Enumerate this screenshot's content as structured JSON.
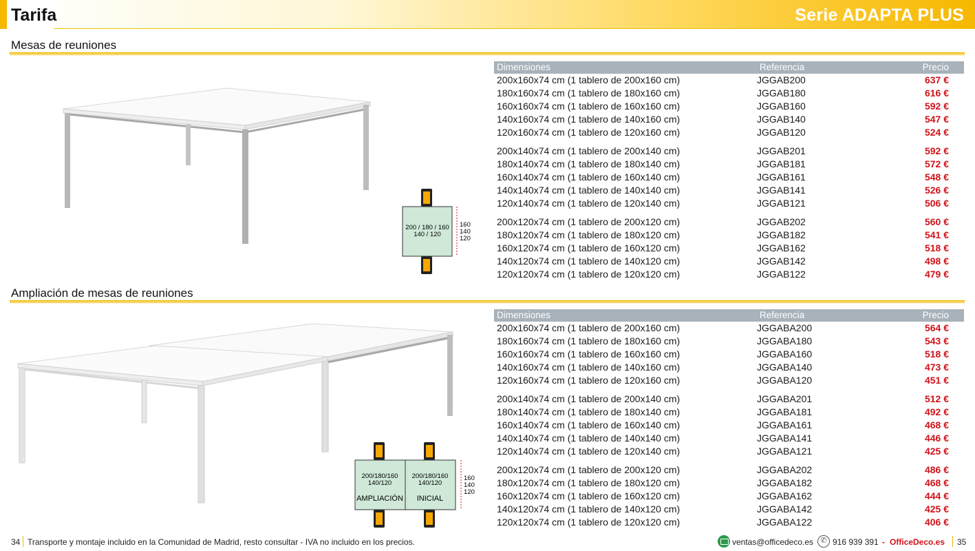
{
  "header": {
    "title": "Tarifa",
    "series": "Serie ADAPTA PLUS"
  },
  "sections": [
    {
      "title": "Mesas de reuniones",
      "table": {
        "headers": {
          "dim": "Dimensiones",
          "ref": "Referencia",
          "price": "Precio"
        },
        "groups": [
          [
            {
              "dim": "200x160x74 cm (1 tablero de 200x160 cm)",
              "ref": "JGGAB200",
              "price": "637 €"
            },
            {
              "dim": "180x160x74 cm (1 tablero de 180x160 cm)",
              "ref": "JGGAB180",
              "price": "616 €"
            },
            {
              "dim": "160x160x74 cm (1 tablero de 160x160 cm)",
              "ref": "JGGAB160",
              "price": "592 €"
            },
            {
              "dim": "140x160x74 cm (1 tablero de 140x160 cm)",
              "ref": "JGGAB140",
              "price": "547 €"
            },
            {
              "dim": "120x160x74 cm (1 tablero de 120x160 cm)",
              "ref": "JGGAB120",
              "price": "524 €"
            }
          ],
          [
            {
              "dim": "200x140x74 cm (1 tablero de 200x140 cm)",
              "ref": "JGGAB201",
              "price": "592 €"
            },
            {
              "dim": "180x140x74 cm (1 tablero de 180x140 cm)",
              "ref": "JGGAB181",
              "price": "572 €"
            },
            {
              "dim": "160x140x74 cm (1 tablero de 160x140 cm)",
              "ref": "JGGAB161",
              "price": "548 €"
            },
            {
              "dim": "140x140x74 cm (1 tablero de 140x140 cm)",
              "ref": "JGGAB141",
              "price": "526 €"
            },
            {
              "dim": "120x140x74 cm (1 tablero de 120x140 cm)",
              "ref": "JGGAB121",
              "price": "506 €"
            }
          ],
          [
            {
              "dim": "200x120x74 cm (1 tablero de 200x120 cm)",
              "ref": "JGGAB202",
              "price": "560 €"
            },
            {
              "dim": "180x120x74 cm (1 tablero de 180x120 cm)",
              "ref": "JGGAB182",
              "price": "541 €"
            },
            {
              "dim": "160x120x74 cm (1 tablero de 160x120 cm)",
              "ref": "JGGAB162",
              "price": "518 €"
            },
            {
              "dim": "140x120x74 cm (1 tablero de 140x120 cm)",
              "ref": "JGGAB142",
              "price": "498 €"
            },
            {
              "dim": "120x120x74 cm (1 tablero de 120x120 cm)",
              "ref": "JGGAB122",
              "price": "479 €"
            }
          ]
        ]
      },
      "diagram": {
        "width_label_1": "200 / 180 / 160",
        "width_label_2": "140 / 120",
        "depth_1": "160",
        "depth_2": "140",
        "depth_3": "120"
      }
    },
    {
      "title": "Ampliación de mesas de reuniones",
      "table": {
        "headers": {
          "dim": "Dimensiones",
          "ref": "Referencia",
          "price": "Precio"
        },
        "groups": [
          [
            {
              "dim": "200x160x74 cm (1 tablero de 200x160 cm)",
              "ref": "JGGABA200",
              "price": "564 €"
            },
            {
              "dim": "180x160x74 cm (1 tablero de 180x160 cm)",
              "ref": "JGGABA180",
              "price": "543 €"
            },
            {
              "dim": "160x160x74 cm (1 tablero de 160x160 cm)",
              "ref": "JGGABA160",
              "price": "518 €"
            },
            {
              "dim": "140x160x74 cm (1 tablero de 140x160 cm)",
              "ref": "JGGABA140",
              "price": "473 €"
            },
            {
              "dim": "120x160x74 cm (1 tablero de 120x160 cm)",
              "ref": "JGGABA120",
              "price": "451 €"
            }
          ],
          [
            {
              "dim": "200x140x74 cm (1 tablero de 200x140 cm)",
              "ref": "JGGABA201",
              "price": "512 €"
            },
            {
              "dim": "180x140x74 cm (1 tablero de 180x140 cm)",
              "ref": "JGGABA181",
              "price": "492 €"
            },
            {
              "dim": "160x140x74 cm (1 tablero de 160x140 cm)",
              "ref": "JGGABA161",
              "price": "468 €"
            },
            {
              "dim": "140x140x74 cm (1 tablero de 140x140 cm)",
              "ref": "JGGABA141",
              "price": "446 €"
            },
            {
              "dim": "120x140x74 cm (1 tablero de 120x140 cm)",
              "ref": "JGGABA121",
              "price": "425 €"
            }
          ],
          [
            {
              "dim": "200x120x74 cm (1 tablero de 200x120 cm)",
              "ref": "JGGABA202",
              "price": "486 €"
            },
            {
              "dim": "180x120x74 cm (1 tablero de 180x120 cm)",
              "ref": "JGGABA182",
              "price": "468 €"
            },
            {
              "dim": "160x120x74 cm (1 tablero de 160x120 cm)",
              "ref": "JGGABA162",
              "price": "444 €"
            },
            {
              "dim": "140x120x74 cm (1 tablero de 140x120 cm)",
              "ref": "JGGABA142",
              "price": "425 €"
            },
            {
              "dim": "120x120x74 cm (1 tablero de 120x120 cm)",
              "ref": "JGGABA122",
              "price": "406 €"
            }
          ]
        ]
      },
      "diagram": {
        "width_label_1": "200/180/160",
        "width_label_2": "140/120",
        "left_label": "AMPLIACIÓN",
        "right_label": "INICIAL",
        "depth_1": "160",
        "depth_2": "140",
        "depth_3": "120"
      }
    }
  ],
  "footer": {
    "page_left": "34",
    "text": "Transporte y montaje incluido en la Comunidad de Madrid, resto consultar - IVA no incluido en los precios.",
    "email": "ventas@officedeco.es",
    "phone": "916 939 391",
    "dash": "-",
    "brand": "OfficeDeco.es",
    "page_right": "35"
  },
  "colors": {
    "accent": "#f0b800",
    "price": "#d0131a",
    "header_bg": "#a7b2ba",
    "diagram_fill": "#cfe8d8",
    "chair": "#f6a800"
  }
}
